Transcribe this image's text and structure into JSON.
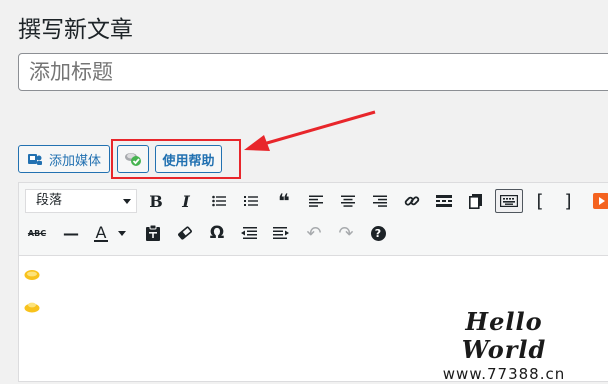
{
  "header": {
    "title": "撰写新文章"
  },
  "title_field": {
    "placeholder": "添加标题",
    "value": ""
  },
  "media_toolbar": {
    "add_media_label": "添加媒体",
    "help_label": "使用帮助"
  },
  "editor_toolbar": {
    "format_select_value": "段落",
    "row1": [
      "bold",
      "italic",
      "bullet-list",
      "numbered-list",
      "blockquote",
      "align-left",
      "align-center",
      "align-right",
      "link",
      "read-more",
      "toolbar-toggle",
      "fullscreen-keyboard",
      "bracket-left",
      "bracket-right",
      "html-tab"
    ],
    "row2": [
      "strikethrough",
      "horizontal-line",
      "text-color",
      "paste-as-text",
      "clear-formatting",
      "special-character",
      "outdent",
      "indent",
      "undo",
      "redo",
      "help"
    ],
    "glyphs": {
      "bold": "B",
      "italic": "I",
      "quote": "❝",
      "link": "🔗",
      "bracket_left": "[",
      "bracket_right": "]",
      "strike": "ABC",
      "hr": "—",
      "text_color": "A",
      "omega": "Ω",
      "undo": "↶",
      "redo": "↷",
      "help": "?"
    }
  },
  "watermark": {
    "title": "Hello World",
    "url": "www.77388.cn"
  },
  "colors": {
    "accent": "#2271b1",
    "highlight": "#e8262b",
    "background": "#f1f1f1"
  }
}
